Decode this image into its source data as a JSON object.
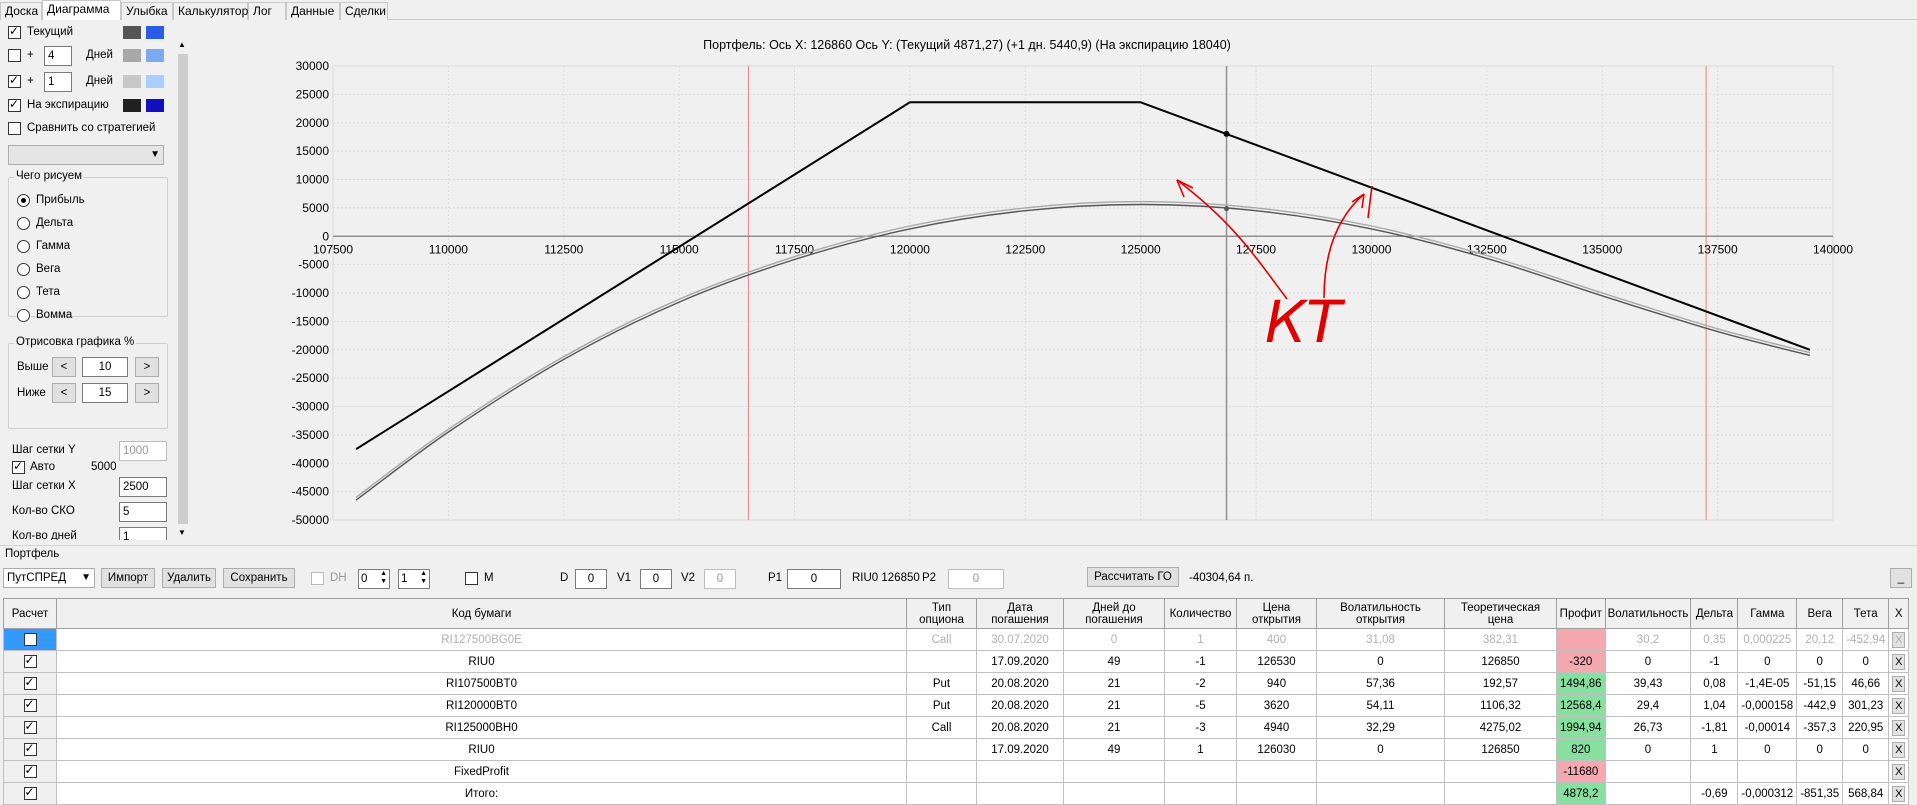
{
  "tabs": [
    "Доска",
    "Диаграмма",
    "Улыбка",
    "Калькулятор",
    "Лог",
    "Данные",
    "Сделки"
  ],
  "active_tab": "Диаграмма",
  "left_panel": {
    "current_label": "Текущий",
    "plus": "+",
    "days_label": "Дней",
    "days1": "4",
    "days2": "1",
    "expiration_label": "На экспирацию",
    "compare_label": "Сравнить со стратегией",
    "what_draw_title": "Чего рисуем",
    "radios": [
      "Прибыль",
      "Дельта",
      "Гамма",
      "Вега",
      "Тета",
      "Вомма"
    ],
    "draw_title": "Отрисовка графика %",
    "above_label": "Выше",
    "above_value": "10",
    "below_label": "Ниже",
    "below_value": "15",
    "btn_left": "<",
    "btn_right": ">",
    "grid_y_label": "Шаг сетки Y",
    "grid_y_value": "1000",
    "auto_label": "Авто",
    "auto_value": "5000",
    "grid_x_label": "Шаг сетки X",
    "grid_x_value": "2500",
    "sko_label": "Кол-во СКО",
    "sko_value": "5",
    "days_count_label": "Кол-во дней",
    "days_count_value": "1",
    "colors": {
      "current_dark": "#555555",
      "current_light": "#2b5ce6",
      "d4_dark": "#a8a8a8",
      "d4_light": "#7aaaf0",
      "d1_dark": "#c8c8c8",
      "d1_light": "#a8d0ff",
      "exp_dark": "#202020",
      "exp_light": "#1010c0"
    }
  },
  "chart": {
    "title": "Портфель: Ось X: 126860 Ось Y:  (Текущий 4871,27)  (+1 дн. 5440,9)  (На экспирацию 18040)",
    "annotation": "КТ"
  },
  "chart_data": {
    "type": "line",
    "xlim": [
      107500,
      140000
    ],
    "ylim": [
      -50000,
      30000
    ],
    "x_ticks": [
      "107500",
      "110000",
      "112500",
      "115000",
      "117500",
      "120000",
      "122500",
      "125000",
      "127500",
      "130000",
      "132500",
      "135000",
      "137500",
      "140000"
    ],
    "y_ticks": [
      "30000",
      "25000",
      "20000",
      "15000",
      "10000",
      "5000",
      "0",
      "-5000",
      "-10000",
      "-15000",
      "-20000",
      "-25000",
      "-30000",
      "-35000",
      "-40000",
      "-45000",
      "-50000"
    ],
    "cursor_x": 126860,
    "red_lines": [
      116500,
      137250
    ],
    "series": [
      {
        "color": "#000000",
        "x": [
          108000,
          120000,
          125000,
          139500
        ],
        "y": [
          -37500,
          23600,
          23600,
          -20000
        ]
      },
      {
        "color": "#555555",
        "x": [
          108000,
          110000,
          112500,
          115000,
          117500,
          120000,
          122500,
          125000,
          127500,
          130000,
          132500,
          135000,
          137500,
          139500
        ],
        "y": [
          -46500,
          -34500,
          -21700,
          -11600,
          -4100,
          1300,
          4500,
          5600,
          4500,
          1300,
          -3900,
          -10500,
          -16800,
          -21000
        ]
      },
      {
        "color": "#a8a8a8",
        "x": [
          108000,
          110000,
          112500,
          115000,
          117500,
          120000,
          122500,
          125000,
          127500,
          130000,
          132500,
          135000,
          137500,
          139500
        ],
        "y": [
          -46000,
          -34000,
          -21200,
          -11100,
          -3600,
          1800,
          5000,
          6100,
          5000,
          1800,
          -3400,
          -10000,
          -16300,
          -20500
        ]
      }
    ]
  },
  "portfolio": {
    "label": "Портфель",
    "strategy": "ПутСПРЕД",
    "import": "Импорт",
    "delete": "Удалить",
    "save": "Сохранить",
    "dh": "DH",
    "dh_v1": "0",
    "dh_v2": "1",
    "m": "M",
    "d_label": "D",
    "d_value": "0",
    "v1_label": "V1",
    "v1_value": "0",
    "v2_label": "V2",
    "v2_value": "0",
    "p1_label": "P1",
    "p1_value": "0",
    "riu_text": "RIU0 126850",
    "p2_label": "P2",
    "p2_value": "0",
    "calc_go": "Рассчитать ГО",
    "go_value": "-40304,64 п.",
    "collapse": "_"
  },
  "table": {
    "headers": [
      "Расчет",
      "Код бумаги",
      "Тип опциона",
      "Дата погашения",
      "Дней до погашения",
      "Количество",
      "Цена открытия",
      "Волатильность открытия",
      "Теоретическая цена",
      "Профит",
      "Волатильность",
      "Дельта",
      "Гамма",
      "Вега",
      "Тета",
      "X"
    ],
    "rows": [
      {
        "code": "RI127500BG0E",
        "type": "Call",
        "date": "30.07.2020",
        "days": "0",
        "qty": "1",
        "open": "400",
        "vol_open": "31,08",
        "theo": "382,31",
        "profit": "",
        "vol": "30,2",
        "delta": "0,35",
        "gamma": "0,000225",
        "vega": "20,12",
        "theta": "-452,94",
        "x": "X"
      },
      {
        "code": "RIU0",
        "type": "",
        "date": "17.09.2020",
        "days": "49",
        "qty": "-1",
        "open": "126530",
        "vol_open": "0",
        "theo": "126850",
        "profit": "-320",
        "vol": "0",
        "delta": "-1",
        "gamma": "0",
        "vega": "0",
        "theta": "0",
        "x": "X"
      },
      {
        "code": "RI107500BT0",
        "type": "Put",
        "date": "20.08.2020",
        "days": "21",
        "qty": "-2",
        "open": "940",
        "vol_open": "57,36",
        "theo": "192,57",
        "profit": "1494,86",
        "vol": "39,43",
        "delta": "0,08",
        "gamma": "-1,4E-05",
        "vega": "-51,15",
        "theta": "46,66",
        "x": "X"
      },
      {
        "code": "RI120000BT0",
        "type": "Put",
        "date": "20.08.2020",
        "days": "21",
        "qty": "-5",
        "open": "3620",
        "vol_open": "54,11",
        "theo": "1106,32",
        "profit": "12568,4",
        "vol": "29,4",
        "delta": "1,04",
        "gamma": "-0,000158",
        "vega": "-442,9",
        "theta": "301,23",
        "x": "X"
      },
      {
        "code": "RI125000BH0",
        "type": "Call",
        "date": "20.08.2020",
        "days": "21",
        "qty": "-3",
        "open": "4940",
        "vol_open": "32,29",
        "theo": "4275,02",
        "profit": "1994,94",
        "vol": "26,73",
        "delta": "-1,81",
        "gamma": "-0,00014",
        "vega": "-357,3",
        "theta": "220,95",
        "x": "X"
      },
      {
        "code": "RIU0",
        "type": "",
        "date": "17.09.2020",
        "days": "49",
        "qty": "1",
        "open": "126030",
        "vol_open": "0",
        "theo": "126850",
        "profit": "820",
        "vol": "0",
        "delta": "1",
        "gamma": "0",
        "vega": "0",
        "theta": "0",
        "x": "X"
      },
      {
        "code": "FixedProfit",
        "type": "",
        "date": "",
        "days": "",
        "qty": "",
        "open": "",
        "vol_open": "",
        "theo": "",
        "profit": "-11680",
        "vol": "",
        "delta": "",
        "gamma": "",
        "vega": "",
        "theta": "",
        "x": "X"
      },
      {
        "code": "Итого:",
        "type": "",
        "date": "",
        "days": "",
        "qty": "",
        "open": "",
        "vol_open": "",
        "theo": "",
        "profit": "4878,2",
        "vol": "",
        "delta": "-0,69",
        "gamma": "-0,000312",
        "vega": "-851,35",
        "theta": "568,84",
        "x": "X"
      }
    ]
  }
}
